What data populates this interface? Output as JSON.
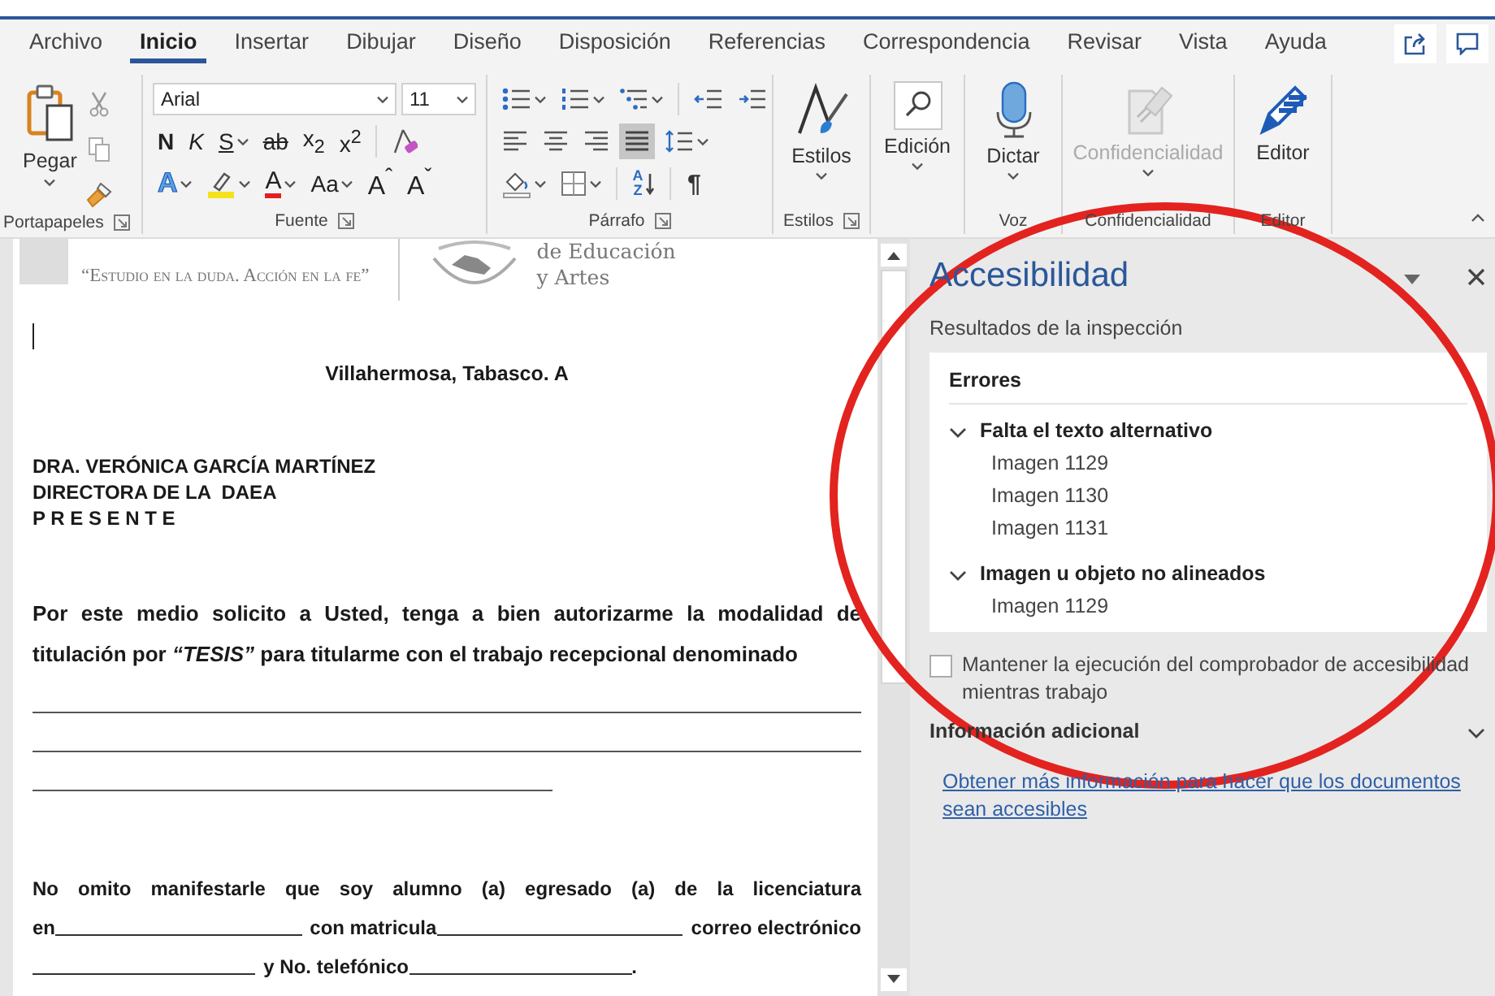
{
  "tabs": [
    {
      "label": "Archivo",
      "selected": false
    },
    {
      "label": "Inicio",
      "selected": true
    },
    {
      "label": "Insertar",
      "selected": false
    },
    {
      "label": "Dibujar",
      "selected": false
    },
    {
      "label": "Diseño",
      "selected": false
    },
    {
      "label": "Disposición",
      "selected": false
    },
    {
      "label": "Referencias",
      "selected": false
    },
    {
      "label": "Correspondencia",
      "selected": false
    },
    {
      "label": "Revisar",
      "selected": false
    },
    {
      "label": "Vista",
      "selected": false
    },
    {
      "label": "Ayuda",
      "selected": false
    }
  ],
  "ribbon": {
    "groups": [
      {
        "kind": "clipboard",
        "label": "Portapapeles",
        "launcher": true,
        "paste": "Pegar"
      },
      {
        "kind": "font",
        "label": "Fuente",
        "launcher": true,
        "font_name": "Arial",
        "font_size": "11",
        "format_buttons": [
          {
            "kind": "bold",
            "text": "N"
          },
          {
            "kind": "italic",
            "text": "K"
          },
          {
            "kind": "underline",
            "text": "S"
          },
          {
            "kind": "strike",
            "text": "ab"
          },
          {
            "kind": "sub",
            "text": "x$_{2}$"
          },
          {
            "kind": "super",
            "text": "x$^{2}$"
          }
        ],
        "color_buttons": [
          {
            "kind": "effects",
            "text": "A"
          },
          {
            "kind": "highlight"
          },
          {
            "kind": "color",
            "text": "A"
          },
          {
            "kind": "case",
            "text": "Aa"
          },
          {
            "kind": "grow",
            "text": "A$^{ˆ}$"
          },
          {
            "kind": "shrink",
            "text": "A$^{ˇ}$"
          }
        ]
      },
      {
        "kind": "paragraph",
        "label": "Párrafo",
        "launcher": true,
        "alignments": [
          {
            "selected": false
          },
          {
            "selected": false
          },
          {
            "selected": false
          },
          {
            "selected": true
          }
        ],
        "sort": "AZ",
        "marks": "¶"
      },
      {
        "kind": "styles",
        "label": "Estilos",
        "launcher": true,
        "button": "Estilos",
        "disabled": false
      },
      {
        "kind": "editing",
        "launcher": false,
        "button": "Edición",
        "disabled": false
      },
      {
        "kind": "voice",
        "label": "Voz",
        "launcher": false,
        "button": "Dictar",
        "disabled": false
      },
      {
        "kind": "sensitivity",
        "label": "Confidencialidad",
        "launcher": false,
        "button": "Confidencialidad",
        "disabled": true
      },
      {
        "kind": "editor",
        "label": "Editor",
        "launcher": false,
        "button": "Editor",
        "disabled": false
      }
    ]
  },
  "document": {
    "motto": "“Estudio en la duda. Acción en la fe”",
    "institution": [
      "de Educación",
      "y Artes"
    ],
    "date_line": "Villahermosa, Tabasco. A",
    "recipient": [
      "DRA. VERÓNICA GARCÍA MARTÍNEZ",
      "DIRECTORA DE LA  DAEA",
      "P R E S E N T E"
    ],
    "request": "Por este medio solicito a Usted, tenga a bien autorizarme la modalidad de titulación por *“TESIS”* para titularme con el trabajo recepcional denominado",
    "answer_lines": [
      {
        "kind": "full"
      },
      {
        "kind": "full"
      },
      {
        "kind": "partial"
      }
    ],
    "details": [
      [
        {
          "kind": "text",
          "text": "No omito manifestarle que soy alumno (a) egresado (a) de la licenciatura"
        }
      ],
      [
        {
          "kind": "text",
          "text": "en"
        },
        {
          "kind": "blank"
        },
        {
          "kind": "text",
          "text": "con matricula"
        },
        {
          "kind": "blank"
        },
        {
          "kind": "text",
          "text": "correo electrónico"
        }
      ],
      [
        {
          "kind": "blank"
        },
        {
          "kind": "text",
          "text": "y No. telefónico"
        },
        {
          "kind": "blank"
        },
        {
          "kind": "text",
          "text": "."
        }
      ]
    ]
  },
  "accessibility_pane": {
    "title": "Accesibilidad",
    "subtitle": "Resultados de la inspección",
    "results": {
      "heading": "Errores",
      "groups": [
        {
          "title": "Falta el texto alternativo",
          "expanded": true,
          "items": [
            "Imagen 1129",
            "Imagen 1130",
            "Imagen 1131"
          ]
        },
        {
          "title": "Imagen u objeto no alineados",
          "expanded": true,
          "items": [
            "Imagen 1129"
          ]
        }
      ]
    },
    "keep_running": {
      "label": "Mantener la ejecución del comprobador de accesibilidad mientras trabajo",
      "checked": false
    },
    "more_info": {
      "title": "Información adicional",
      "expanded": false
    },
    "link": "Obtener más información para hacer que los documentos sean accesibles"
  }
}
